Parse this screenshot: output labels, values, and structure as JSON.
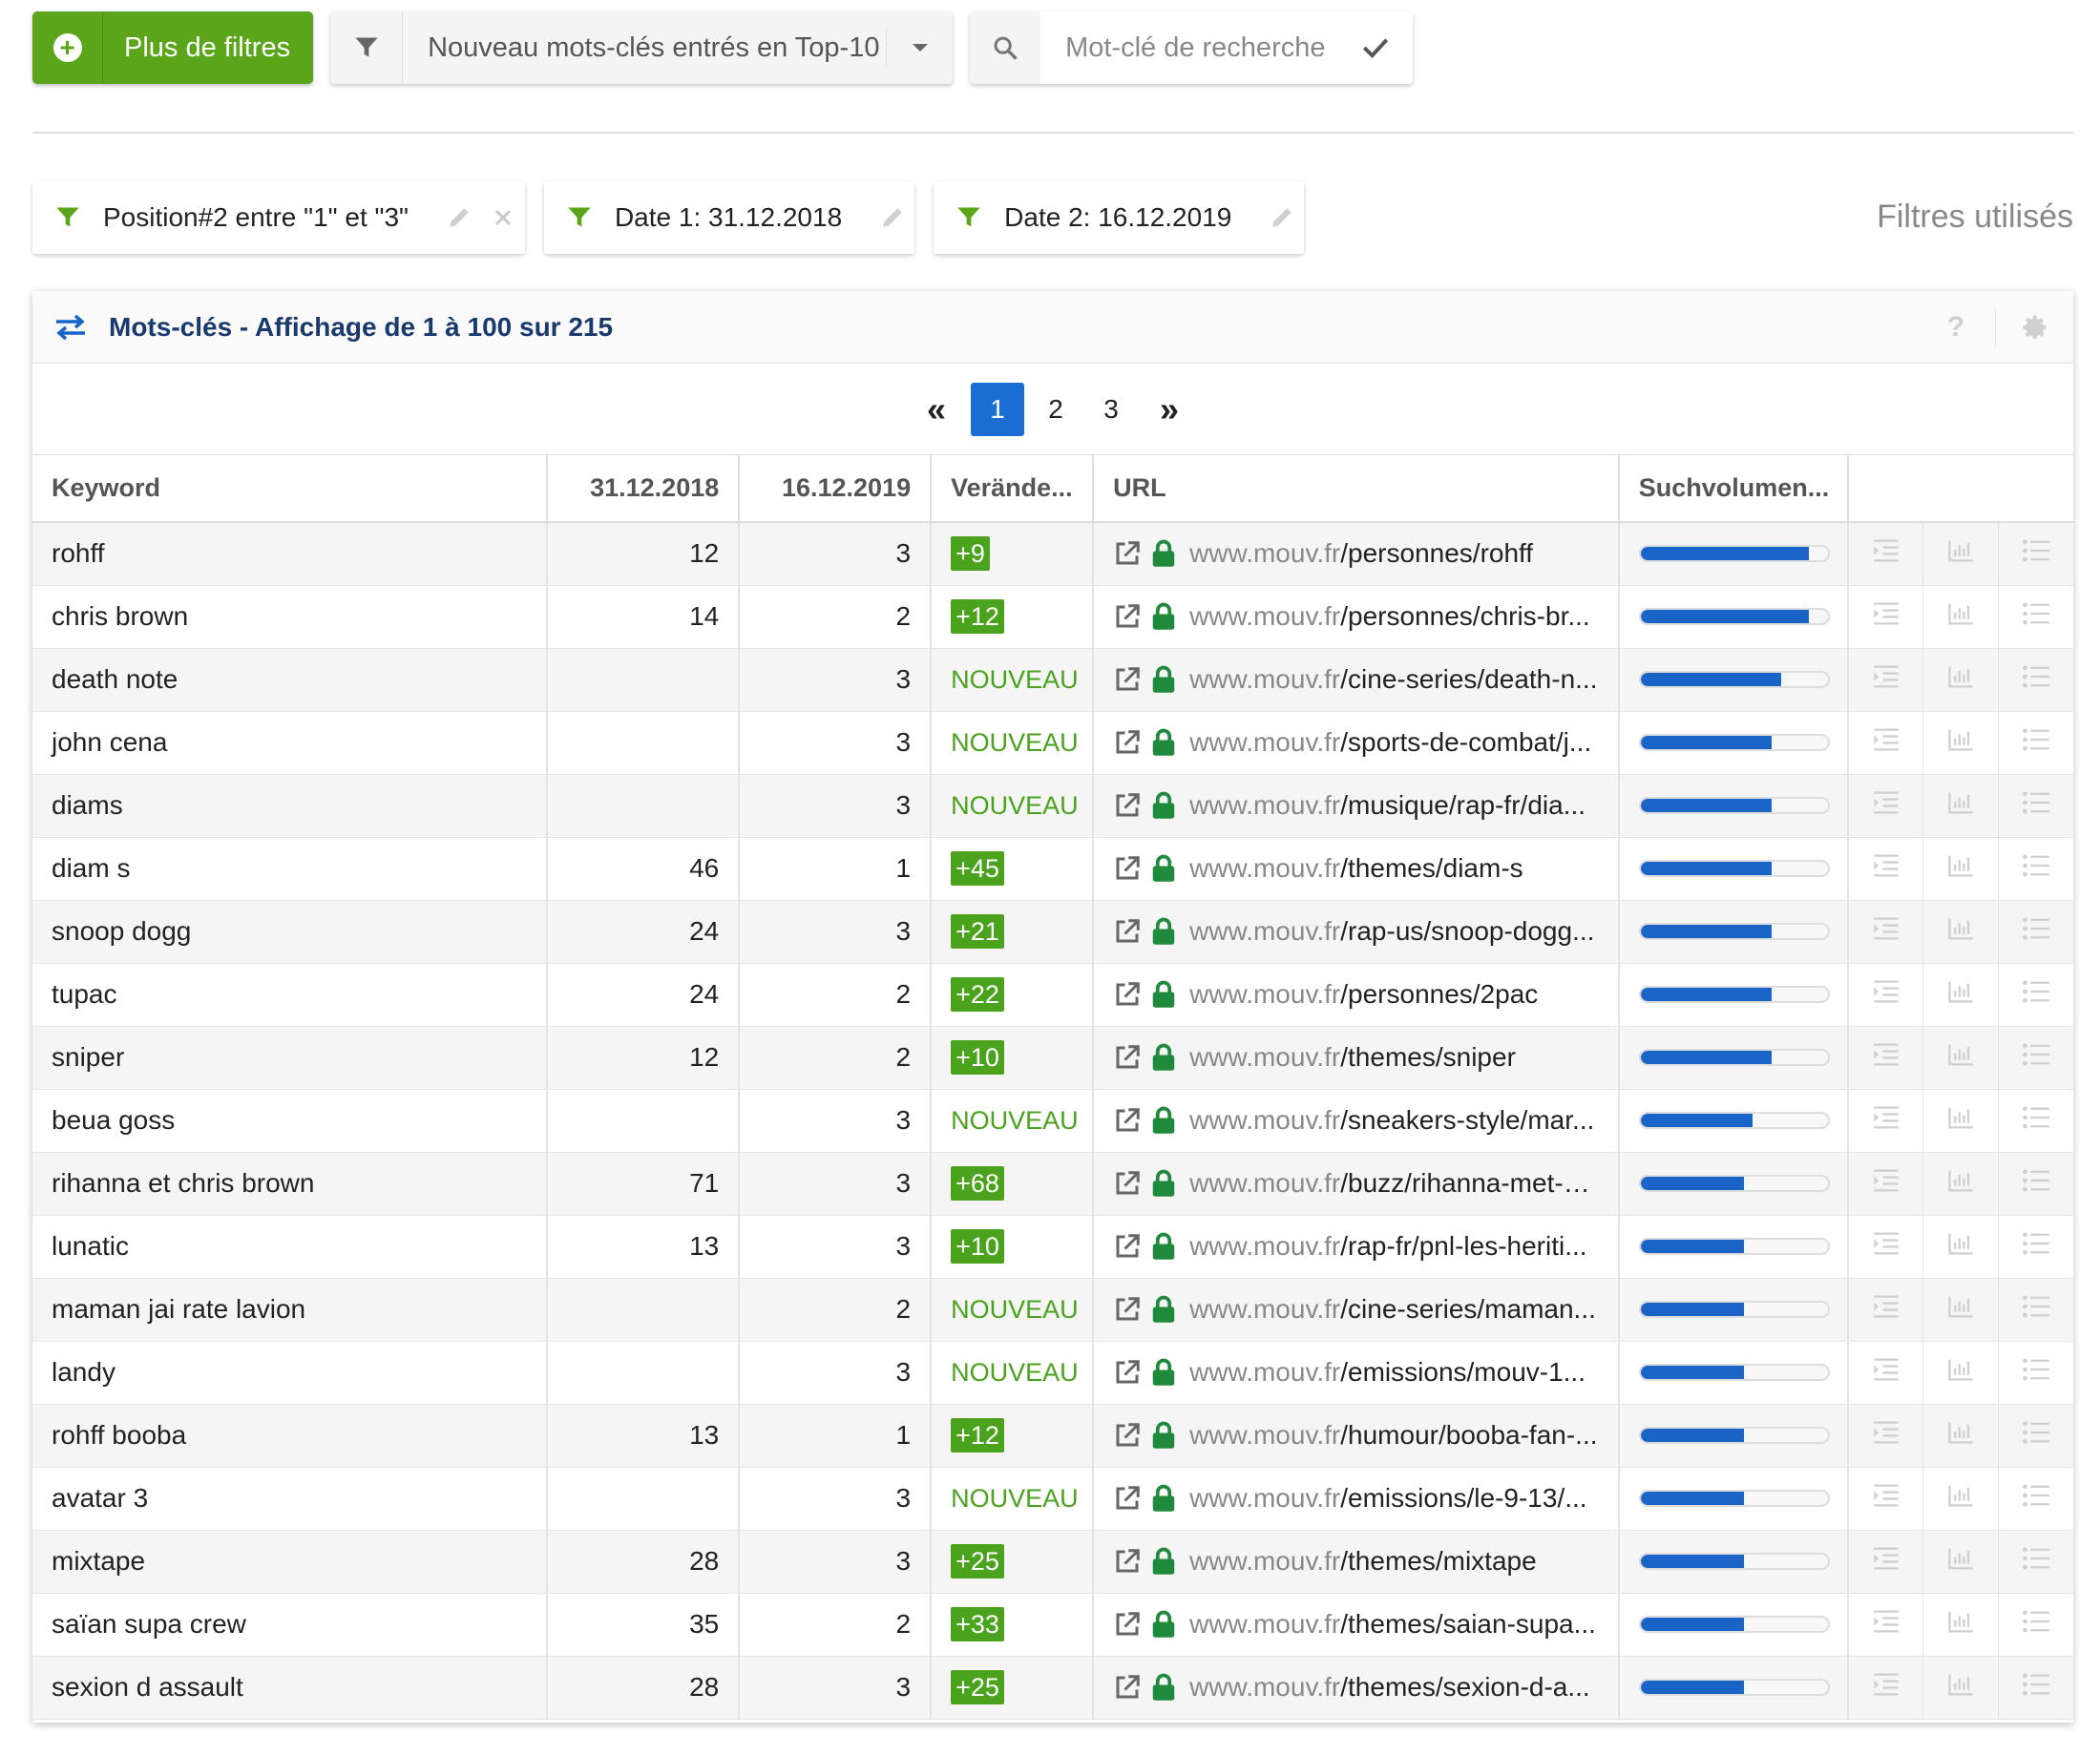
{
  "toolbar": {
    "more_filters_label": "Plus de filtres",
    "preset_filter_label": "Nouveau mots-clés entrés en Top-10",
    "search_placeholder": "Mot-clé de recherche"
  },
  "active_filters": [
    {
      "label": "Position#2 entre \"1\" et \"3\"",
      "removable": true
    },
    {
      "label": "Date 1: 31.12.2018",
      "removable": false
    },
    {
      "label": "Date 2: 16.12.2019",
      "removable": false
    }
  ],
  "filters_used_label": "Filtres utilisés",
  "panel": {
    "title": "Mots-clés - Affichage de 1 à 100 sur 215",
    "help_label": "?"
  },
  "pagination": {
    "first_label": "«",
    "pages": [
      "1",
      "2",
      "3"
    ],
    "current_page": "1",
    "last_label": "»"
  },
  "table": {
    "columns": [
      "Keyword",
      "31.12.2018",
      "16.12.2019",
      "Verände...",
      "URL",
      "Suchvolumen...",
      ""
    ],
    "rows": [
      {
        "keyword": "rohff",
        "pos1": "12",
        "pos2": "3",
        "change": "+9",
        "domain": "www.mouv.fr",
        "path": "/personnes/rohff",
        "volume": 0.9
      },
      {
        "keyword": "chris brown",
        "pos1": "14",
        "pos2": "2",
        "change": "+12",
        "domain": "www.mouv.fr",
        "path": "/personnes/chris-br...",
        "volume": 0.9
      },
      {
        "keyword": "death note",
        "pos1": "",
        "pos2": "3",
        "change": "NOUVEAU",
        "domain": "www.mouv.fr",
        "path": "/cine-series/death-n...",
        "volume": 0.75
      },
      {
        "keyword": "john cena",
        "pos1": "",
        "pos2": "3",
        "change": "NOUVEAU",
        "domain": "www.mouv.fr",
        "path": "/sports-de-combat/j...",
        "volume": 0.7
      },
      {
        "keyword": "diams",
        "pos1": "",
        "pos2": "3",
        "change": "NOUVEAU",
        "domain": "www.mouv.fr",
        "path": "/musique/rap-fr/dia...",
        "volume": 0.7
      },
      {
        "keyword": "diam s",
        "pos1": "46",
        "pos2": "1",
        "change": "+45",
        "domain": "www.mouv.fr",
        "path": "/themes/diam-s",
        "volume": 0.7
      },
      {
        "keyword": "snoop dogg",
        "pos1": "24",
        "pos2": "3",
        "change": "+21",
        "domain": "www.mouv.fr",
        "path": "/rap-us/snoop-dogg...",
        "volume": 0.7
      },
      {
        "keyword": "tupac",
        "pos1": "24",
        "pos2": "2",
        "change": "+22",
        "domain": "www.mouv.fr",
        "path": "/personnes/2pac",
        "volume": 0.7
      },
      {
        "keyword": "sniper",
        "pos1": "12",
        "pos2": "2",
        "change": "+10",
        "domain": "www.mouv.fr",
        "path": "/themes/sniper",
        "volume": 0.7
      },
      {
        "keyword": "beua goss",
        "pos1": "",
        "pos2": "3",
        "change": "NOUVEAU",
        "domain": "www.mouv.fr",
        "path": "/sneakers-style/mar...",
        "volume": 0.6
      },
      {
        "keyword": "rihanna et chris brown",
        "pos1": "71",
        "pos2": "3",
        "change": "+68",
        "domain": "www.mouv.fr",
        "path": "/buzz/rihanna-met-c...",
        "volume": 0.55
      },
      {
        "keyword": "lunatic",
        "pos1": "13",
        "pos2": "3",
        "change": "+10",
        "domain": "www.mouv.fr",
        "path": "/rap-fr/pnl-les-heriti...",
        "volume": 0.55
      },
      {
        "keyword": "maman jai rate lavion",
        "pos1": "",
        "pos2": "2",
        "change": "NOUVEAU",
        "domain": "www.mouv.fr",
        "path": "/cine-series/maman...",
        "volume": 0.55
      },
      {
        "keyword": "landy",
        "pos1": "",
        "pos2": "3",
        "change": "NOUVEAU",
        "domain": "www.mouv.fr",
        "path": "/emissions/mouv-1...",
        "volume": 0.55
      },
      {
        "keyword": "rohff booba",
        "pos1": "13",
        "pos2": "1",
        "change": "+12",
        "domain": "www.mouv.fr",
        "path": "/humour/booba-fan-...",
        "volume": 0.55
      },
      {
        "keyword": "avatar 3",
        "pos1": "",
        "pos2": "3",
        "change": "NOUVEAU",
        "domain": "www.mouv.fr",
        "path": "/emissions/le-9-13/...",
        "volume": 0.55
      },
      {
        "keyword": "mixtape",
        "pos1": "28",
        "pos2": "3",
        "change": "+25",
        "domain": "www.mouv.fr",
        "path": "/themes/mixtape",
        "volume": 0.55
      },
      {
        "keyword": "saïan supa crew",
        "pos1": "35",
        "pos2": "2",
        "change": "+33",
        "domain": "www.mouv.fr",
        "path": "/themes/saian-supa...",
        "volume": 0.55
      },
      {
        "keyword": "sexion d assault",
        "pos1": "28",
        "pos2": "3",
        "change": "+25",
        "domain": "www.mouv.fr",
        "path": "/themes/sexion-d-a...",
        "volume": 0.55
      }
    ]
  },
  "colors": {
    "accent_green": "#5aa51a",
    "badge_green": "#4aa21d",
    "primary_blue": "#1b6fd4",
    "title_navy": "#1a3a6e",
    "lock_green": "#1f8a3c"
  }
}
